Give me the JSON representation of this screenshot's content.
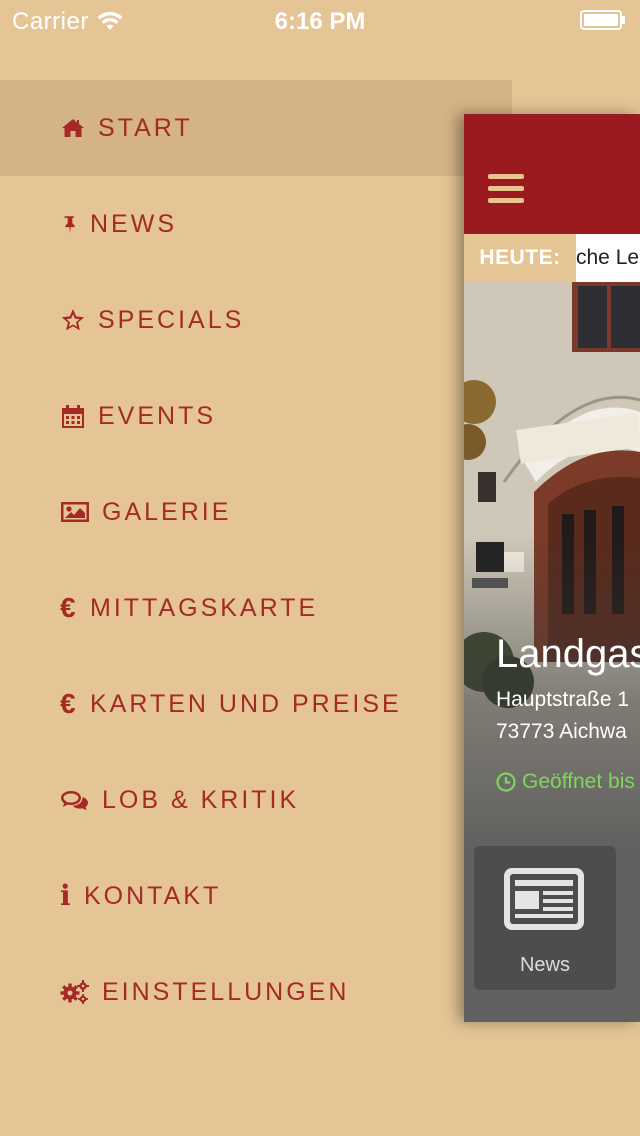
{
  "status_bar": {
    "carrier": "Carrier",
    "time": "6:16 PM"
  },
  "menu": {
    "items": [
      {
        "label": "START",
        "icon": "home-icon",
        "active": true
      },
      {
        "label": "NEWS",
        "icon": "pushpin-icon"
      },
      {
        "label": "SPECIALS",
        "icon": "star-outline-icon"
      },
      {
        "label": "EVENTS",
        "icon": "calendar-icon"
      },
      {
        "label": "GALERIE",
        "icon": "picture-icon"
      },
      {
        "label": "MITTAGSKARTE",
        "icon": "euro-icon",
        "glyph": "€"
      },
      {
        "label": "KARTEN UND PREISE",
        "icon": "euro-icon",
        "glyph": "€"
      },
      {
        "label": "LOB & KRITIK",
        "icon": "comments-icon"
      },
      {
        "label": "KONTAKT",
        "icon": "info-icon",
        "glyph": "i"
      },
      {
        "label": "EINSTELLUNGEN",
        "icon": "gears-icon"
      }
    ]
  },
  "preview": {
    "ticker_label": "HEUTE:",
    "ticker_text": "che Le",
    "restaurant_name": "Landgas",
    "address_line1": "Hauptstraße 1",
    "address_line2": "73773 Aichwa",
    "open_status": "Geöffnet bis",
    "tile_label": "News"
  },
  "colors": {
    "background": "#e5c596",
    "accent": "#a52a26",
    "header": "#9b1a1f",
    "open_green": "#7fd65a"
  }
}
